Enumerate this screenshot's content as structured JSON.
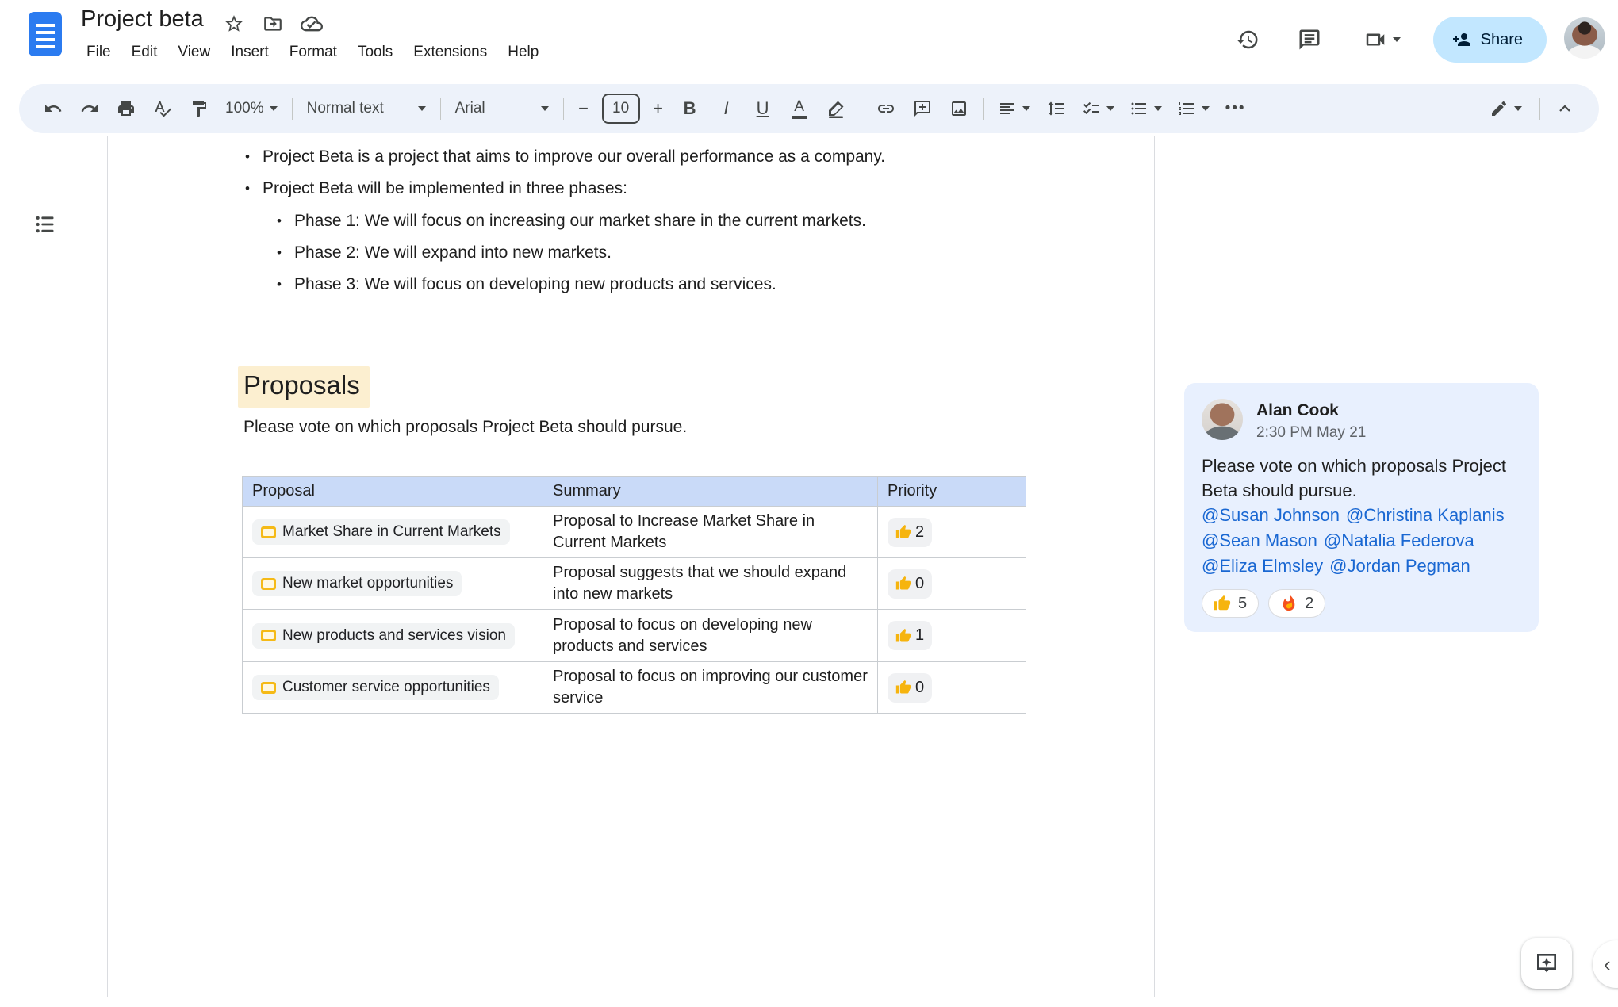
{
  "header": {
    "doc_title": "Project beta",
    "menu": [
      "File",
      "Edit",
      "View",
      "Insert",
      "Format",
      "Tools",
      "Extensions",
      "Help"
    ],
    "share_label": "Share"
  },
  "toolbar": {
    "zoom_level": "100%",
    "paragraph_style": "Normal text",
    "font_family": "Arial",
    "font_size": "10",
    "bold_glyph": "B",
    "italic_glyph": "I",
    "underline_glyph": "U",
    "text_color_glyph": "A",
    "minus_glyph": "−",
    "plus_glyph": "+",
    "more_glyph": "•••",
    "collapse_glyph": "‹"
  },
  "document": {
    "bullets": [
      "Project Beta is a project that aims to improve our overall performance as a company.",
      "Project Beta will be implemented in three phases:"
    ],
    "sub_bullets": [
      "Phase 1: We will focus on increasing our market share in the current markets.",
      "Phase 2: We will expand into new markets.",
      "Phase 3: We will focus on developing new products and services."
    ],
    "heading": "Proposals",
    "intro": "Please vote on which proposals Project Beta should pursue.",
    "table": {
      "headers": [
        "Proposal",
        "Summary",
        "Priority"
      ],
      "rows": [
        {
          "proposal": "Market Share in Current Markets",
          "summary": "Proposal to Increase Market Share in Current Markets",
          "votes": "2"
        },
        {
          "proposal": "New market opportunities",
          "summary": "Proposal suggests that we should expand into new markets",
          "votes": "0"
        },
        {
          "proposal": "New products and services vision",
          "summary": "Proposal to focus on developing new products and services",
          "votes": "1"
        },
        {
          "proposal": "Customer service opportunities",
          "summary": "Proposal to focus on improving our customer service",
          "votes": "0"
        }
      ]
    }
  },
  "comment": {
    "author": "Alan Cook",
    "timestamp": "2:30 PM May 21",
    "body": "Please vote on which proposals Project Beta should pursue.",
    "mentions": [
      "@Susan Johnson",
      "@Christina Kaplanis",
      "@Sean Mason",
      "@Natalia Federova",
      "@Eliza Elmsley",
      "@Jordan Pegman"
    ],
    "reactions": [
      {
        "icon": "thumbs-up",
        "count": "5"
      },
      {
        "icon": "fire",
        "count": "2"
      }
    ]
  },
  "colors": {
    "share_button_bg": "#c2e7ff",
    "toolbar_bg": "#edf2fa",
    "table_header_bg": "#c9daf8",
    "comment_card_bg": "#e8f0fe",
    "mention_link": "#1967d2",
    "heading_highlight": "#fcefd0",
    "chip_icon_yellow": "#f5ba17"
  }
}
